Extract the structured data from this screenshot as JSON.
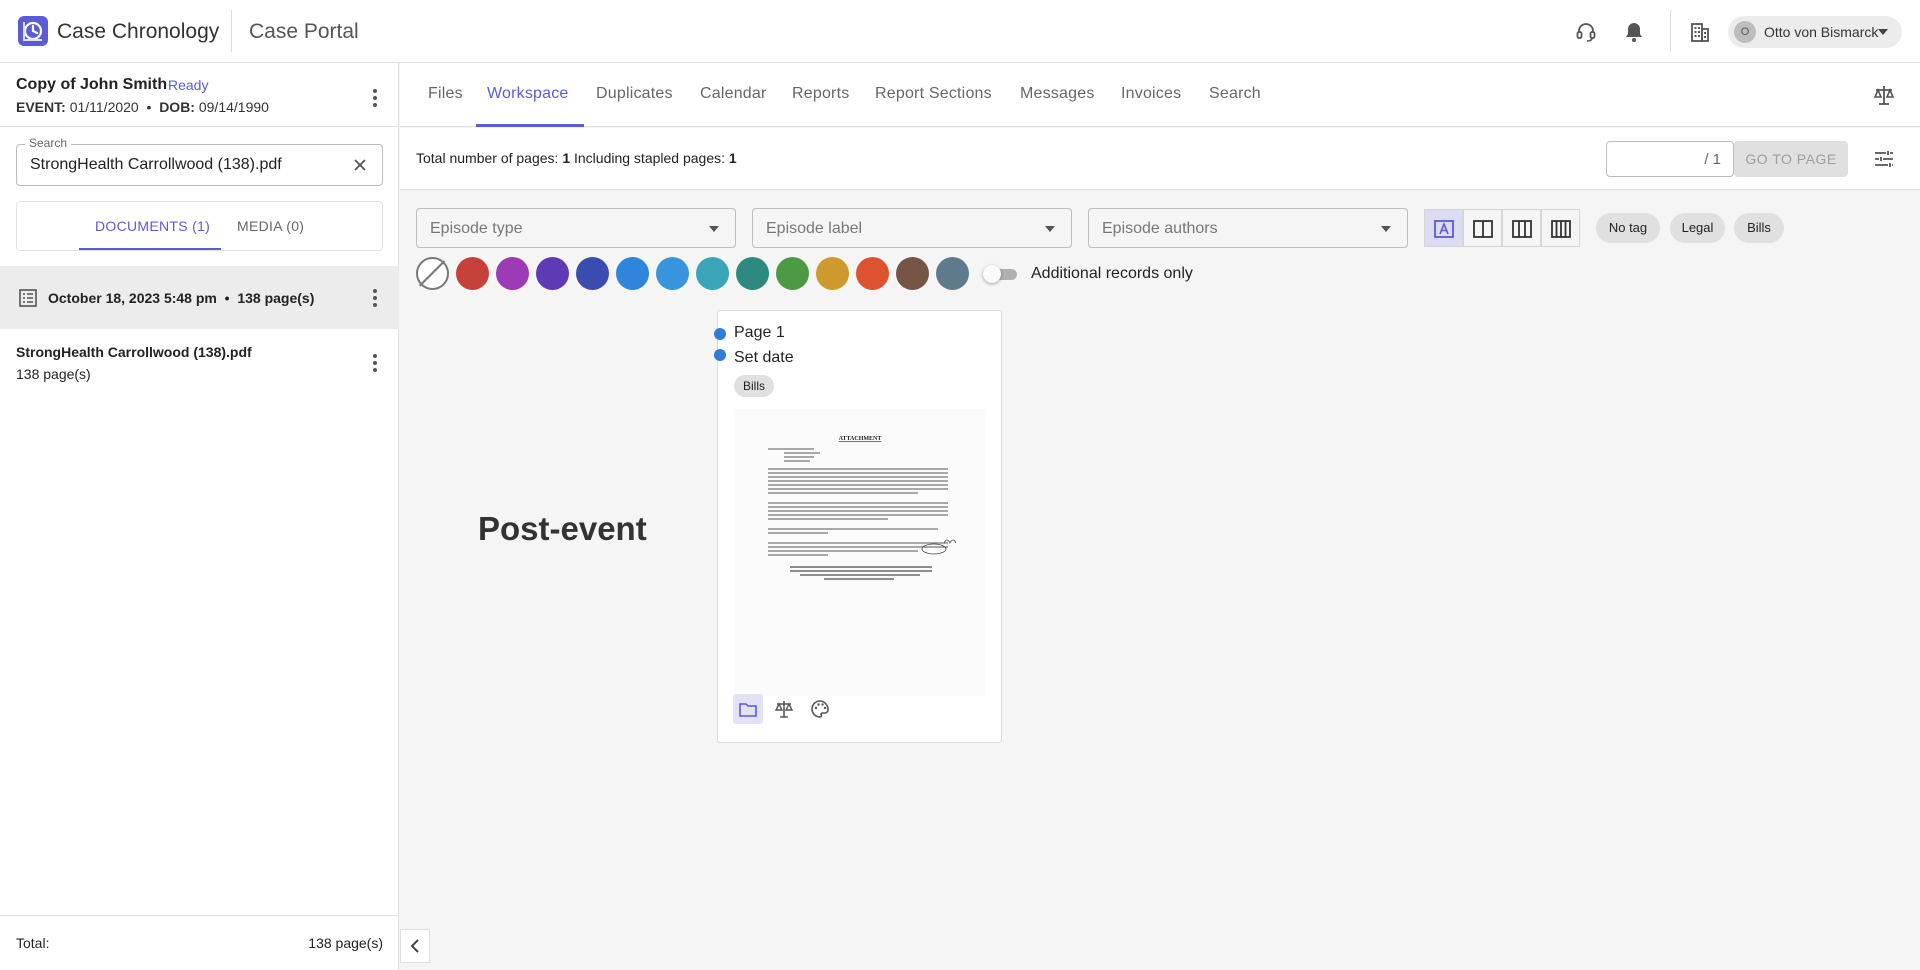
{
  "app": {
    "brand": "Case Chronology",
    "portal": "Case Portal",
    "user_initial": "O",
    "user_name": "Otto von Bismarck",
    "accent": "#5b5bd6"
  },
  "case": {
    "name": "Copy of John Smith",
    "status": "Ready",
    "event_label": "EVENT:",
    "event_date": "01/11/2020",
    "dob_label": "DOB:",
    "dob": "09/14/1990"
  },
  "search": {
    "label": "Search",
    "value": "StrongHealth Carrollwood (138).pdf"
  },
  "doc_tabs": [
    {
      "label": "DOCUMENTS (1)",
      "active": true
    },
    {
      "label": "MEDIA (0)",
      "active": false
    }
  ],
  "group": {
    "date": "October 18, 2023 5:48 pm",
    "separator": "•",
    "pages": "138 page(s)"
  },
  "document": {
    "name": "StrongHealth Carrollwood (138).pdf",
    "pages": "138 page(s)"
  },
  "totals": {
    "label": "Total:",
    "value": "138 page(s)"
  },
  "nav_tabs": [
    "Files",
    "Workspace",
    "Duplicates",
    "Calendar",
    "Reports",
    "Report Sections",
    "Messages",
    "Invoices",
    "Search"
  ],
  "nav_active": "Workspace",
  "info": {
    "pages_label": "Total number of pages:",
    "pages_value": "1",
    "stapled_label": "Including stapled pages:",
    "stapled_value": "1",
    "page_total": "/ 1",
    "goto_label": "GO TO PAGE"
  },
  "filters": {
    "episode_type": "Episode type",
    "episode_label": "Episode label",
    "episode_authors": "Episode authors"
  },
  "tag_chips": [
    "No tag",
    "Legal",
    "Bills"
  ],
  "swatch_colors": [
    "#c8403a",
    "#9c3bb5",
    "#5e3ab4",
    "#3b4cb0",
    "#2f84db",
    "#3895dd",
    "#3aa4b8",
    "#2c8a80",
    "#4d9a45",
    "#cf9a2c",
    "#dd5330",
    "#765446",
    "#5f7b8b"
  ],
  "toggle": {
    "label": "Additional records only",
    "on": false
  },
  "section_label": "Post-event",
  "card": {
    "page": "Page 1",
    "date": "Set date",
    "tag": "Bills",
    "thumb_title": "ATTACHMENT"
  }
}
